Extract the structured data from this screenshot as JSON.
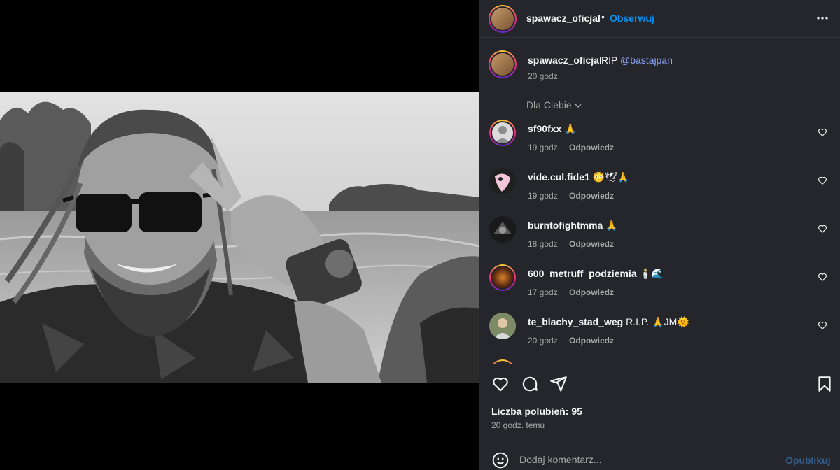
{
  "post": {
    "media_description_icon": "photo",
    "author": {
      "username": "spawacz_oficjal",
      "separator": "•",
      "follow_label": "Obserwuj"
    },
    "caption": {
      "username": "spawacz_oficjal",
      "text": "RIP ",
      "mention": "@bastajpan",
      "time": "20 godz."
    },
    "filter_label": "Dla Ciebie",
    "comments": [
      {
        "username": "sf90fxx",
        "text": "🙏",
        "time": "19 godz.",
        "reply_label": "Odpowiedz"
      },
      {
        "username": "vide.cul.fide1",
        "text": "😳🕊🙏",
        "time": "19 godz.",
        "reply_label": "Odpowiedz"
      },
      {
        "username": "burntofightmma",
        "text": "🙏",
        "time": "18 godz.",
        "reply_label": "Odpowiedz"
      },
      {
        "username": "600_metruff_podziemia",
        "text": "🕯️🌊",
        "time": "17 godz.",
        "reply_label": "Odpowiedz"
      },
      {
        "username": "te_blachy_stad_weg",
        "text": "R.I.P. 🙏JM🌞",
        "time": "20 godz.",
        "reply_label": "Odpowiedz"
      }
    ],
    "likes_text": "Liczba polubień: 95",
    "posted_time": "20 godz. temu",
    "comment_placeholder": "Dodaj komentarz...",
    "publish_label": "Opublikuj"
  },
  "colors": {
    "panel_bg": "#25262b",
    "accent_blue": "#0095f6",
    "mention": "#8ea5ff",
    "muted": "#a8a8a8"
  }
}
